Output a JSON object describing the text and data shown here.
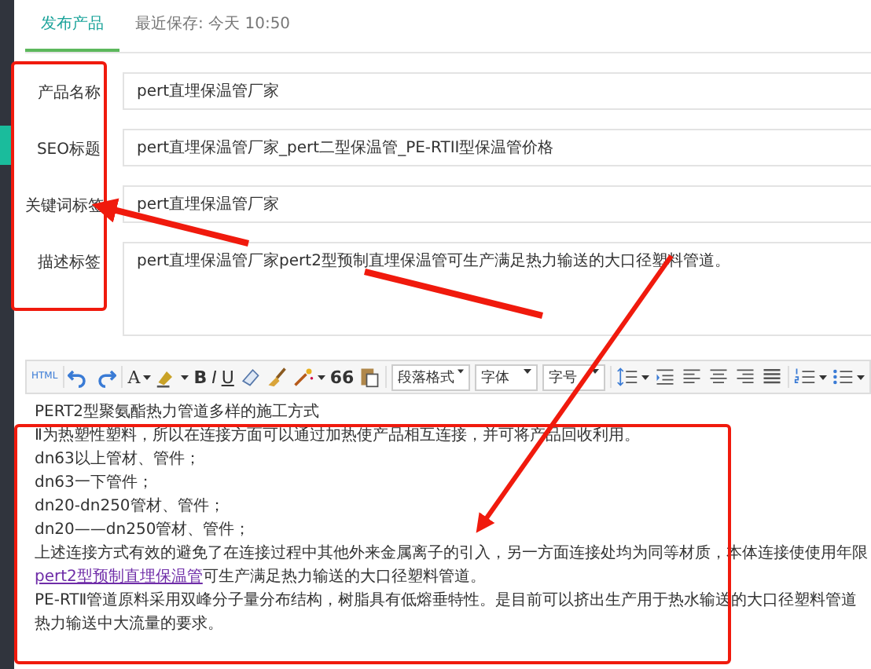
{
  "tabs": [
    {
      "label": "发布产品",
      "selected": true
    },
    {
      "label": "最近保存: 今天 10:50",
      "selected": false
    }
  ],
  "form": [
    {
      "label": "产品名称",
      "kind": "input",
      "value": "pert直埋保温管厂家"
    },
    {
      "label": "SEO标题",
      "kind": "input",
      "value": "pert直埋保温管厂家_pert二型保温管_PE-RTII型保温管价格"
    },
    {
      "label": "关键词标签",
      "kind": "input",
      "value": "pert直埋保温管厂家"
    },
    {
      "label": "描述标签",
      "kind": "textarea",
      "value": "pert直埋保温管厂家pert2型预制直埋保温管可生产满足热力输送的大口径塑料管道。"
    }
  ],
  "toolbar": [
    {
      "kind": "html",
      "text": "HTML"
    },
    {
      "kind": "sep"
    },
    {
      "kind": "undo"
    },
    {
      "kind": "redo"
    },
    {
      "kind": "sep"
    },
    {
      "kind": "fontcolor",
      "text": "A",
      "caret": true
    },
    {
      "kind": "highlight",
      "caret": true
    },
    {
      "kind": "bold",
      "text": "B"
    },
    {
      "kind": "italic",
      "text": "I"
    },
    {
      "kind": "underline",
      "text": "U"
    },
    {
      "kind": "eraser"
    },
    {
      "kind": "brush"
    },
    {
      "kind": "wand",
      "caret": true
    },
    {
      "kind": "quote",
      "text": "66"
    },
    {
      "kind": "paste"
    },
    {
      "kind": "sep"
    },
    {
      "kind": "select",
      "text": "段落格式"
    },
    {
      "kind": "select",
      "text": "字体"
    },
    {
      "kind": "select",
      "text": "字号"
    },
    {
      "kind": "sep"
    },
    {
      "kind": "lineheight",
      "caret": true
    },
    {
      "kind": "indent"
    },
    {
      "kind": "align-left"
    },
    {
      "kind": "align-center"
    },
    {
      "kind": "align-right"
    },
    {
      "kind": "align-justify"
    },
    {
      "kind": "sep"
    },
    {
      "kind": "ol",
      "caret": true
    },
    {
      "kind": "ul",
      "caret": true
    }
  ],
  "content": [
    {
      "text": "PERT2型聚氨酯热力管道多样的施工方式"
    },
    {
      "text": "Ⅱ为热塑性塑料，所以在连接方面可以通过加热使产品相互连接，并可将产品回收利用。"
    },
    {
      "text": "dn63以上管材、管件；"
    },
    {
      "text": "dn63一下管件；"
    },
    {
      "text": "dn20-dn250管材、管件；"
    },
    {
      "text": "dn20——dn250管材、管件；"
    },
    {
      "text": "上述连接方式有效的避免了在连接过程中其他外来金属离子的引入，另一方面连接处均为同等材质，本体连接使使用年限"
    },
    {
      "link": "pert2型预制直埋保温管",
      "text": "可生产满足热力输送的大口径塑料管道。"
    },
    {
      "text": "PE-RTⅡ管道原料采用双峰分子量分布结构，树脂具有低熔垂特性。是目前可以挤出生产用于热水输送的大口径塑料管道"
    },
    {
      "text": "热力输送中大流量的要求。"
    }
  ]
}
